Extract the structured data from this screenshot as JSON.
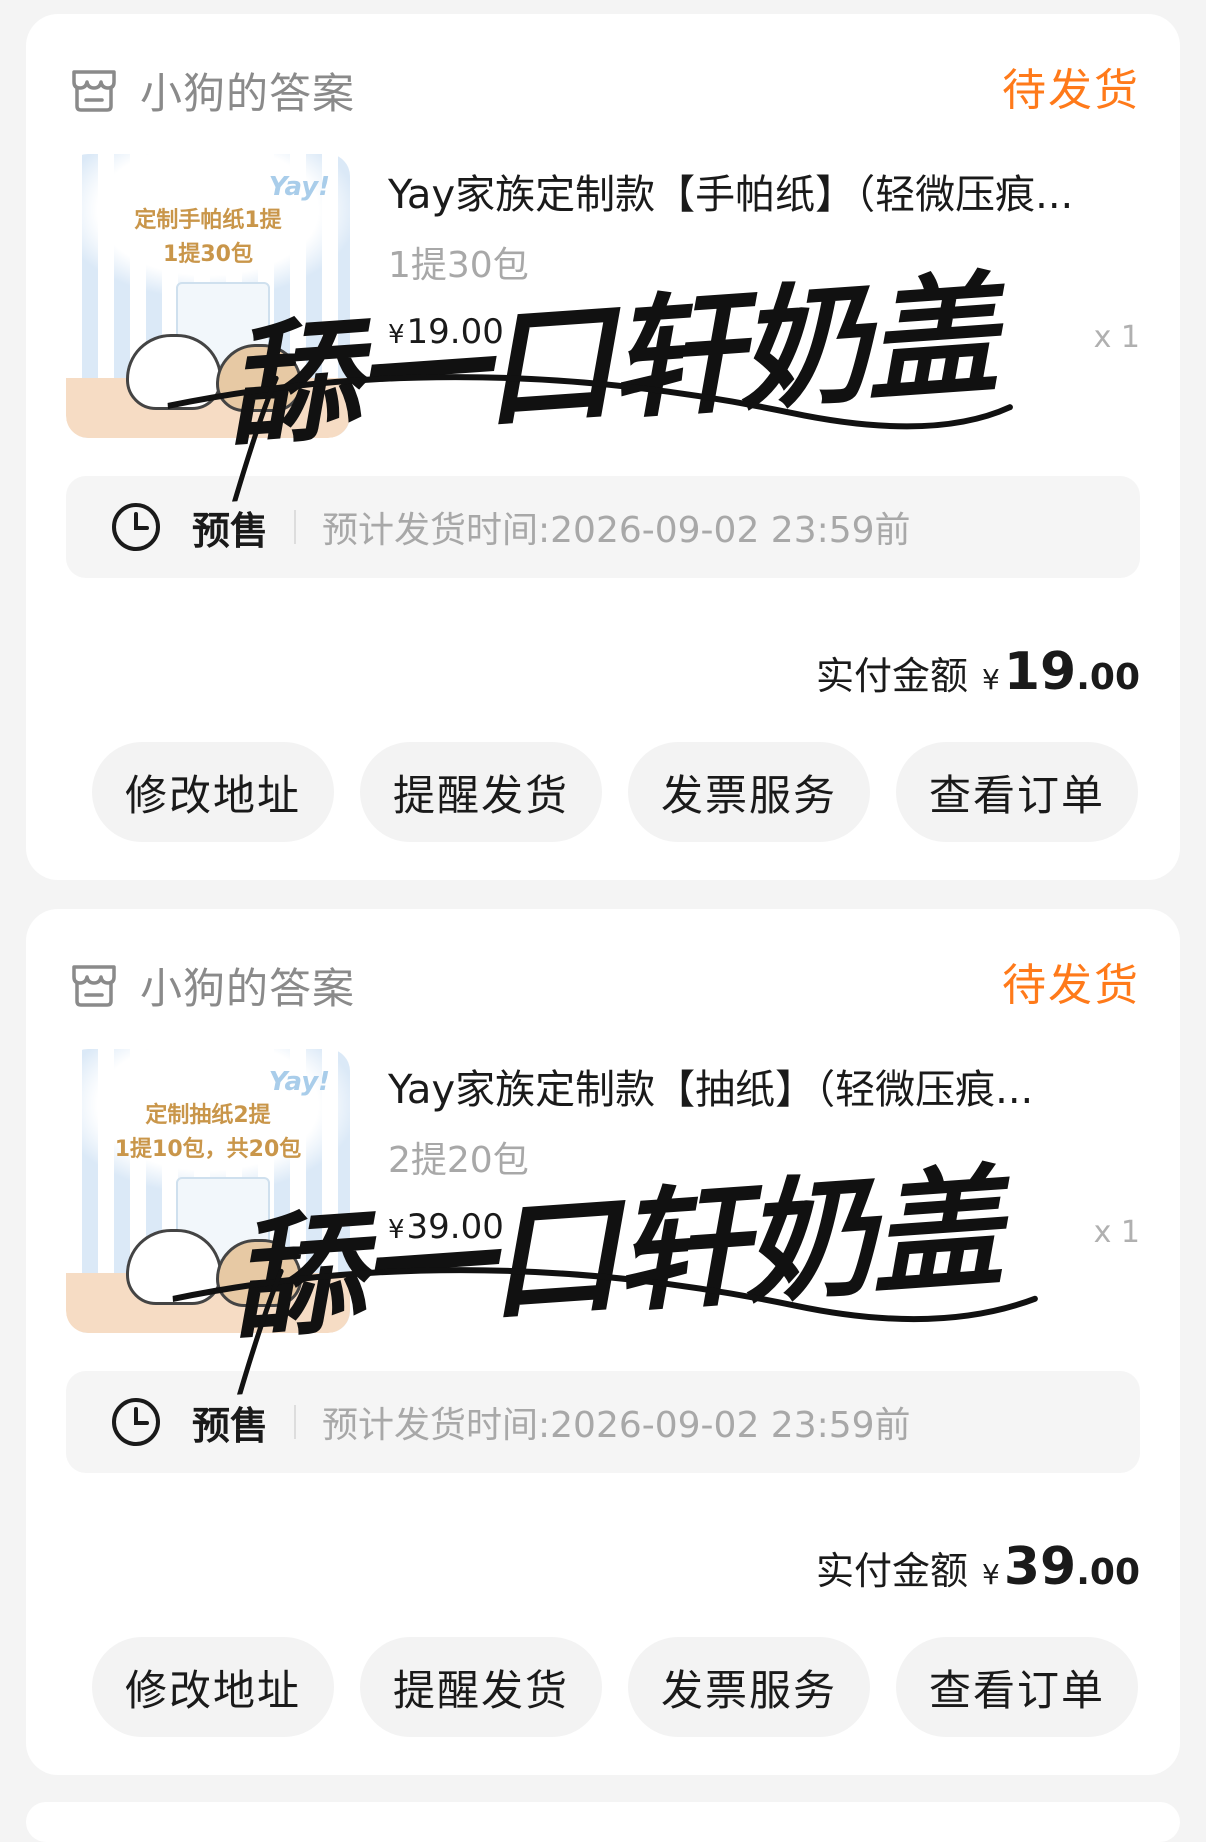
{
  "orders": [
    {
      "shop_name": "小狗的答案",
      "status": "待发货",
      "thumb": {
        "line1": "定制手帕纸1提",
        "line2": "1提30包",
        "brand": "Yay!"
      },
      "title": "Yay家族定制款【手帕纸】（轻微压痕...",
      "spec": "1提30包",
      "price_symbol": "¥",
      "price": "19.00",
      "qty": "x 1",
      "presale_tag": "预售",
      "presale_text": "预计发货时间:2026-09-02 23:59前",
      "paid_label": "实付金额",
      "paid_symbol": "¥",
      "paid_int": "19",
      "paid_dec": ".00",
      "buttons": [
        "修改地址",
        "提醒发货",
        "发票服务",
        "查看订单"
      ],
      "watermark": "舔一口轩奶盖"
    },
    {
      "shop_name": "小狗的答案",
      "status": "待发货",
      "thumb": {
        "line1": "定制抽纸2提",
        "line2": "1提10包，共20包",
        "brand": "Yay!"
      },
      "title": "Yay家族定制款【抽纸】（轻微压痕...",
      "spec": "2提20包",
      "price_symbol": "¥",
      "price": "39.00",
      "qty": "x 1",
      "presale_tag": "预售",
      "presale_text": "预计发货时间:2026-09-02 23:59前",
      "paid_label": "实付金额",
      "paid_symbol": "¥",
      "paid_int": "39",
      "paid_dec": ".00",
      "buttons": [
        "修改地址",
        "提醒发货",
        "发票服务",
        "查看订单"
      ],
      "watermark": "舔一口轩奶盖"
    }
  ],
  "colors": {
    "status": "#ff7a1a",
    "page_bg": "#f4f4f4",
    "button_bg": "#f3f3f3"
  }
}
